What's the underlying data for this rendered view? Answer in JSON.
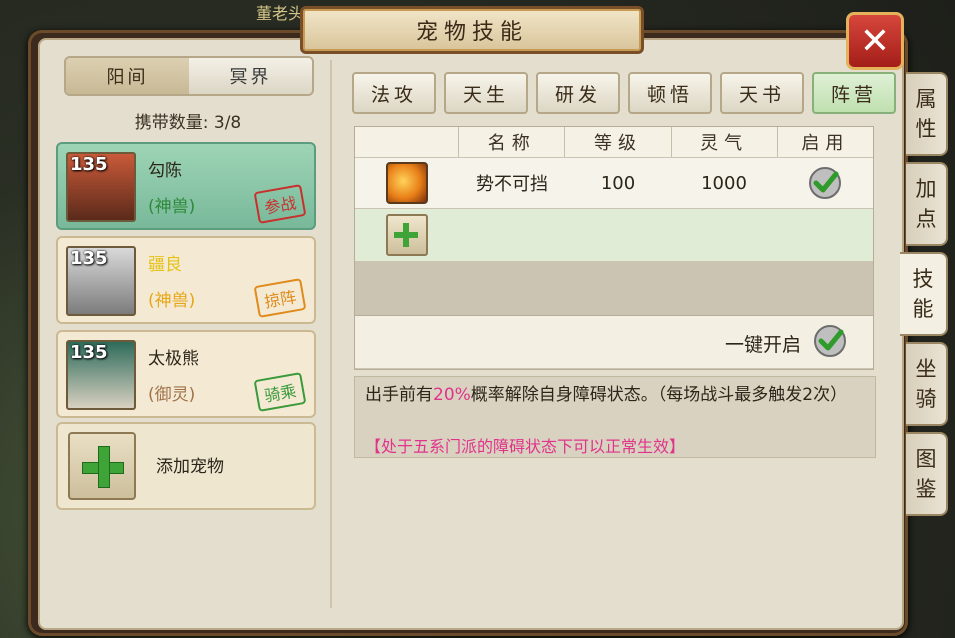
{
  "window": {
    "title": "宠物技能",
    "close_label": "✕"
  },
  "bg_text": "董老头",
  "realm_tabs": [
    {
      "label": "阳间",
      "active": true
    },
    {
      "label": "冥界",
      "active": false
    }
  ],
  "carry": {
    "label": "携带数量:",
    "value": "3/8"
  },
  "pets": [
    {
      "level": "135",
      "name": "勾陈",
      "type": "(神兽)",
      "role": "参战",
      "role_color": "#c9302c",
      "type_color": "#2f8a3b",
      "selected": true
    },
    {
      "level": "135",
      "name": "疆良",
      "type": "(神兽)",
      "role": "掠阵",
      "role_color": "#e08a1b",
      "type_color": "#e6a617",
      "selected": false
    },
    {
      "level": "135",
      "name": "太极熊",
      "type": "(御灵)",
      "role": "骑乘",
      "role_color": "#3a9a3a",
      "type_color": "#a0724a",
      "selected": false
    }
  ],
  "add_pet_label": "添加宠物",
  "skill_tabs": [
    {
      "label": "法攻",
      "active": false
    },
    {
      "label": "天生",
      "active": false
    },
    {
      "label": "研发",
      "active": false
    },
    {
      "label": "顿悟",
      "active": false
    },
    {
      "label": "天书",
      "active": false
    },
    {
      "label": "阵营",
      "active": true
    }
  ],
  "table": {
    "headers": [
      "名称",
      "等级",
      "灵气",
      "启用"
    ],
    "rows": [
      {
        "icon": "fist-skill-icon",
        "name": "势不可挡",
        "level": "100",
        "aura": "1000",
        "enabled": true
      }
    ]
  },
  "one_key_label": "一键开启",
  "description": {
    "before": "出手前有",
    "pct": "20%",
    "after": "概率解除自身障碍状态。（每场战斗最多触发2次）",
    "note": "【处于五系门派的障碍状态下可以正常生效】"
  },
  "side_tabs": [
    {
      "label": "属性",
      "active": false
    },
    {
      "label": "加点",
      "active": false
    },
    {
      "label": "技能",
      "active": true
    },
    {
      "label": "坐骑",
      "active": false
    },
    {
      "label": "图鉴",
      "active": false
    }
  ]
}
